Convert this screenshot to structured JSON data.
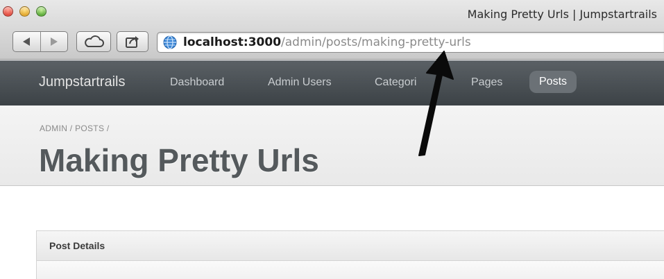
{
  "window": {
    "title": "Making Pretty Urls | Jumpstartrails"
  },
  "toolbar": {
    "back_icon": "back-arrow-icon",
    "forward_icon": "forward-arrow-icon",
    "cloud_icon": "cloud-icon",
    "share_icon": "share-icon"
  },
  "url_bar": {
    "host": "localhost:3000",
    "path": "/admin/posts/making-pretty-urls",
    "icon": "globe-icon"
  },
  "navbar": {
    "brand": "Jumpstartrails",
    "items": [
      {
        "label": "Dashboard",
        "active": false
      },
      {
        "label": "Admin Users",
        "active": false
      },
      {
        "label": "Categori",
        "active": false
      },
      {
        "label": "Pages",
        "active": false
      },
      {
        "label": "Posts",
        "active": true
      }
    ]
  },
  "breadcrumb": {
    "text": "ADMIN / POSTS /"
  },
  "page": {
    "title": "Making Pretty Urls"
  },
  "panel": {
    "title": "Post Details"
  },
  "colors": {
    "navbar": "#4a5055",
    "active_tab": "#6b7176",
    "title_text": "#54595c",
    "url_path": "#8a8a8a"
  }
}
